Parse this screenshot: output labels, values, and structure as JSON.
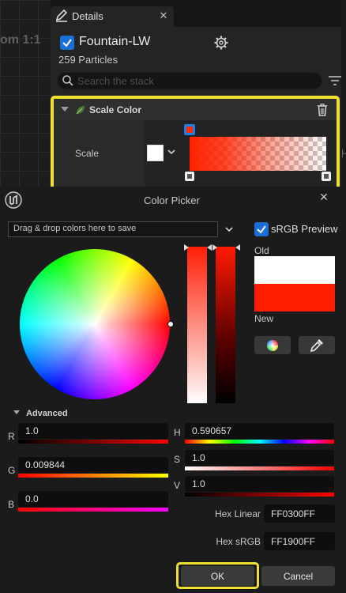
{
  "background": {
    "viewport_label": "om 1:1"
  },
  "details": {
    "tab_label": "Details",
    "tab_close": "✕",
    "emitter_name": "Fountain-LW",
    "particles": "259 Particles",
    "search_placeholder": "Search the stack",
    "module": {
      "title": "Scale Color",
      "row_label": "Scale",
      "swatch_color": "#ffffff",
      "gradient_start": "#ff2200",
      "side_mark": "⊢"
    }
  },
  "picker": {
    "title": "Color Picker",
    "close": "✕",
    "drag_drop_text": "Drag & drop colors here to save",
    "srgb_label": "sRGB Preview",
    "srgb_checked": true,
    "old_label": "Old",
    "new_label": "New",
    "old_color": "#ffffff",
    "new_color": "#ff1f00",
    "advanced_label": "Advanced",
    "channels": {
      "r": {
        "label": "R",
        "value": "1.0"
      },
      "g": {
        "label": "G",
        "value": "0.009844"
      },
      "b": {
        "label": "B",
        "value": "0.0"
      },
      "h": {
        "label": "H",
        "value": "0.590657"
      },
      "s": {
        "label": "S",
        "value": "1.0"
      },
      "v": {
        "label": "V",
        "value": "1.0"
      }
    },
    "hex_linear_label": "Hex Linear",
    "hex_linear_value": "FF0300FF",
    "hex_srgb_label": "Hex sRGB",
    "hex_srgb_value": "FF1900FF",
    "ok_label": "OK",
    "cancel_label": "Cancel",
    "accent_highlight": "#f0e033",
    "checkbox_color": "#1a6fd6"
  }
}
